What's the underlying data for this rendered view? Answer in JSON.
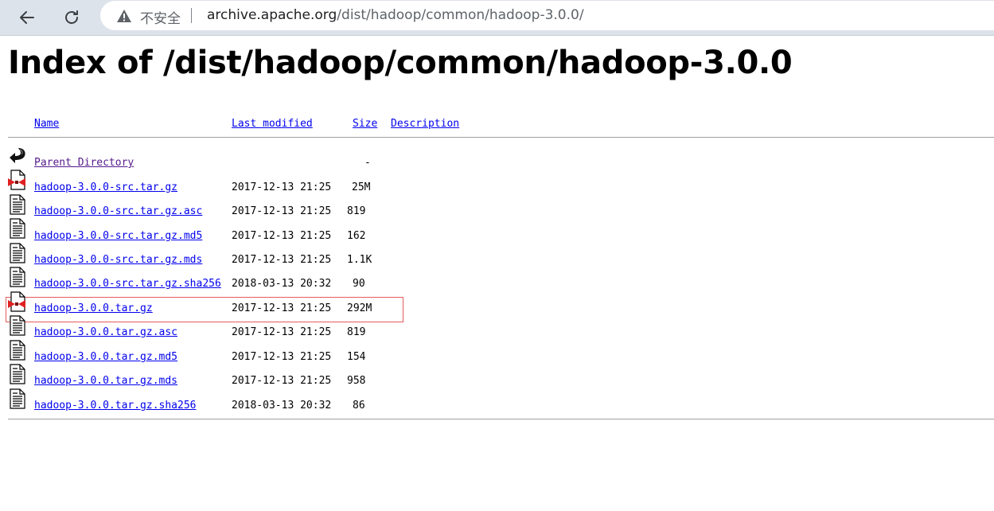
{
  "browser": {
    "back_icon": "back-arrow-icon",
    "reload_icon": "reload-icon",
    "security_icon": "warning-triangle-icon",
    "security_label": "不安全",
    "url_host": "archive.apache.org",
    "url_path": "/dist/hadoop/common/hadoop-3.0.0/"
  },
  "page": {
    "title": "Index of /dist/hadoop/common/hadoop-3.0.0"
  },
  "table": {
    "headers": {
      "name": "Name",
      "last_modified": "Last modified",
      "size": "Size",
      "description": "Description"
    },
    "rows": [
      {
        "icon": "parent-directory-icon",
        "name": "Parent Directory",
        "date": "",
        "size": "-"
      },
      {
        "icon": "compressed-file-icon",
        "name": "hadoop-3.0.0-src.tar.gz",
        "date": "2017-12-13 21:25",
        "size": "25M"
      },
      {
        "icon": "text-file-icon",
        "name": "hadoop-3.0.0-src.tar.gz.asc",
        "date": "2017-12-13 21:25",
        "size": "819"
      },
      {
        "icon": "text-file-icon",
        "name": "hadoop-3.0.0-src.tar.gz.md5",
        "date": "2017-12-13 21:25",
        "size": "162"
      },
      {
        "icon": "text-file-icon",
        "name": "hadoop-3.0.0-src.tar.gz.mds",
        "date": "2017-12-13 21:25",
        "size": "1.1K"
      },
      {
        "icon": "text-file-icon",
        "name": "hadoop-3.0.0-src.tar.gz.sha256",
        "date": "2018-03-13 20:32",
        "size": "90"
      },
      {
        "icon": "compressed-file-icon",
        "name": "hadoop-3.0.0.tar.gz",
        "date": "2017-12-13 21:25",
        "size": "292M"
      },
      {
        "icon": "text-file-icon",
        "name": "hadoop-3.0.0.tar.gz.asc",
        "date": "2017-12-13 21:25",
        "size": "819"
      },
      {
        "icon": "text-file-icon",
        "name": "hadoop-3.0.0.tar.gz.md5",
        "date": "2017-12-13 21:25",
        "size": "154"
      },
      {
        "icon": "text-file-icon",
        "name": "hadoop-3.0.0.tar.gz.mds",
        "date": "2017-12-13 21:25",
        "size": "958"
      },
      {
        "icon": "text-file-icon",
        "name": "hadoop-3.0.0.tar.gz.sha256",
        "date": "2018-03-13 20:32",
        "size": "86"
      }
    ],
    "highlighted_row": "hadoop-3.0.0.tar.gz"
  },
  "colors": {
    "link": "#0000ee",
    "visited_link": "#551a8b",
    "highlight_border": "#e45b5b",
    "toolbar_bg": "#dde3ea"
  }
}
